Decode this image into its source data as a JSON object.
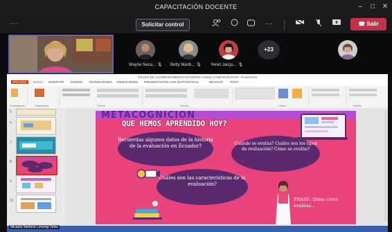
{
  "window": {
    "title": "CAPACITACIÓN DOCENTE",
    "min_glyph": "–",
    "max_glyph": "□",
    "close_glyph": "✕"
  },
  "toolbar": {
    "more_left": "···",
    "request_control": "Solicitar control",
    "more": "···",
    "leave": "Salir"
  },
  "participants": {
    "self_name": "Micaela Marlene Limongi Yelez",
    "people": [
      {
        "name": "Wayne Neca... ",
        "mic_icon": "mic-off-icon"
      },
      {
        "name": "Betty Marib... ",
        "mic_icon": "mic-off-icon"
      },
      {
        "name": "Yenet Jacqu... ",
        "mic_icon": "mic-off-icon"
      }
    ],
    "overflow_count": "+23"
  },
  "powerpoint": {
    "title": "TALLER DE ACOMPAÑAMIENTO DOCENTE 3 (002) CONFIGURATION - PowerPoint",
    "tabs": [
      "ARCHIVO",
      "INICIO",
      "INSERTAR",
      "DISEÑO",
      "TRANSICIONES",
      "ANIMACIONES",
      "PRESENTACIÓN CON DIAPOSITIVAS",
      "REVISAR",
      "VISTA"
    ],
    "ribbon_groups": [
      "Portapapeles",
      "Diapositivas",
      "Fuente",
      "Párrafo",
      "Dibujo",
      "Edición"
    ],
    "thumb_numbers": [
      "5",
      "6",
      "7",
      "8",
      "9",
      "10"
    ]
  },
  "slide": {
    "heading": "METACOGNICIÓN",
    "question": "QUE HEMOS APRENDIDO HOY?",
    "bubble1": "Recuerdas algunos datos de la historia de la evaluación en Ecuador?",
    "bubble2": "Cuándo se evalúa? Cuáles son los tipos de evaluación? Cómo se evalúa?",
    "bubble3": "Cuáles son las características de la evaluación?",
    "frase": "FRASE: Dime cómo evalúas..."
  },
  "colors": {
    "teams_bg": "#0e0e10",
    "accent": "#6264a7",
    "leave_red": "#c4314b",
    "slide_pink": "#e8437d",
    "bubble_purple": "#5b2a6e"
  }
}
